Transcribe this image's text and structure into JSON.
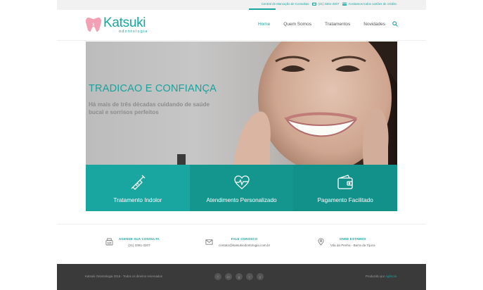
{
  "topbar": {
    "central": "Central de Marcação de Consultas",
    "phone": "(21) 3391-3207",
    "cards": "Aceitamos todos cartões de crédito"
  },
  "header": {
    "logo_name": "Katsuki",
    "logo_sub": "odontologia",
    "nav": [
      "Home",
      "Quem Somos",
      "Tratamentos",
      "Novidades"
    ]
  },
  "hero": {
    "title": "TRADICAO E CONFIANÇA",
    "subtitle": "Há mais de três décadas cuidando de saúde bucal e sorrisos perfeitos"
  },
  "tiles": [
    {
      "label": "Tratamento Indolor",
      "icon": "syringe-icon",
      "color": "#19a6a1"
    },
    {
      "label": "Atendimento Personalizado",
      "icon": "heartbeat-icon",
      "color": "#14968f"
    },
    {
      "label": "Pagamento Facilitado",
      "icon": "wallet-icon",
      "color": "#11918a"
    }
  ],
  "contact": [
    {
      "title": "AGENDE SUA CONSULTA",
      "value": "(21) 3391-3207",
      "icon": "fax-icon"
    },
    {
      "title": "FALE CONOSCO",
      "value": "contato@katsukiodontologia.com.br",
      "icon": "envelope-icon"
    },
    {
      "title": "ONDE ESTAMOS",
      "value": "Vila da Penha  -  Barra da Tijuca",
      "icon": "map-pin-icon"
    }
  ],
  "footer": {
    "copyright": "Katsuki Odontologia 2016 - Todos os direitos reservados",
    "social": [
      "f",
      "in",
      "g",
      "t",
      "y"
    ],
    "credit_prefix": "Produzido por",
    "credit_brand": "Agência"
  },
  "colors": {
    "accent": "#19a6a1",
    "footer": "#3a3a3a"
  }
}
